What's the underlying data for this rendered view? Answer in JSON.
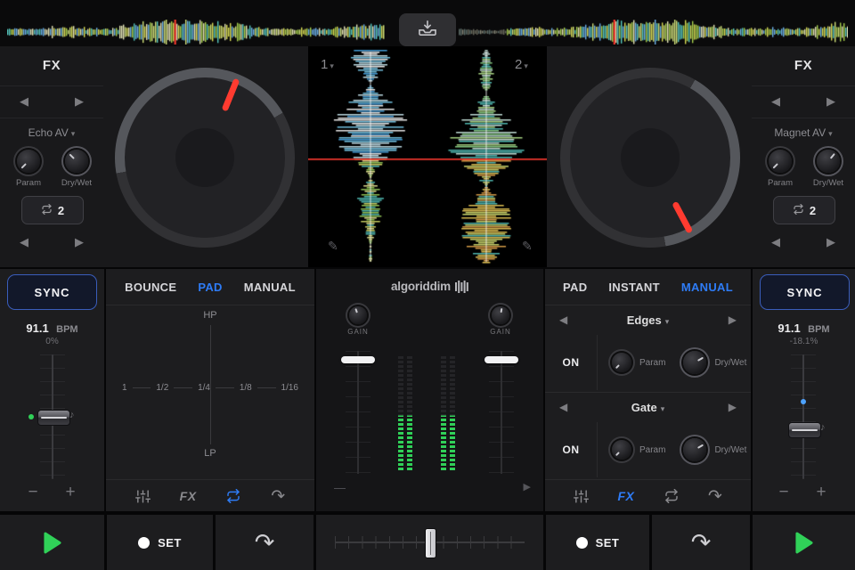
{
  "colors": {
    "accent_blue": "#2e7cf6",
    "playhead_red": "#ff3b30",
    "play_green": "#30d158",
    "meter_green": "#30d158",
    "sync_border": "#3a5dbb"
  },
  "icons": {
    "dropdown": "▾",
    "prev": "◀",
    "next": "▶",
    "redo": "↷",
    "note": "♪",
    "pencil": "✎",
    "minus": "−",
    "plus": "+",
    "dash": "—",
    "mini_next": "▶"
  },
  "center_display": {
    "deck1_label": "1",
    "deck2_label": "2"
  },
  "fx_left": {
    "title": "FX",
    "preset": "Echo AV",
    "param_label": "Param",
    "drywet_label": "Dry/Wet",
    "loop_beats": "2"
  },
  "fx_right": {
    "title": "FX",
    "preset": "Magnet AV",
    "param_label": "Param",
    "drywet_label": "Dry/Wet",
    "loop_beats": "2"
  },
  "deck_left": {
    "sync_label": "SYNC",
    "bpm_value": "91.1",
    "bpm_unit": "BPM",
    "pitch_percent": "0%"
  },
  "deck_right": {
    "sync_label": "SYNC",
    "bpm_value": "91.1",
    "bpm_unit": "BPM",
    "pitch_percent": "-18.1%"
  },
  "pad_left": {
    "tabs": [
      {
        "label": "BOUNCE",
        "active": false
      },
      {
        "label": "PAD",
        "active": true
      },
      {
        "label": "MANUAL",
        "active": false
      }
    ],
    "y_axis_top": "HP",
    "y_axis_bottom": "LP",
    "x_ticks": [
      "1",
      "1/2",
      "1/4",
      "1/8",
      "1/16"
    ],
    "toolbar": {
      "fx_label": "FX",
      "active_loop": true
    }
  },
  "pad_right": {
    "tabs": [
      {
        "label": "PAD",
        "active": false
      },
      {
        "label": "INSTANT",
        "active": false
      },
      {
        "label": "MANUAL",
        "active": true
      }
    ],
    "fx_slots": [
      {
        "name": "Edges",
        "on_label": "ON",
        "param_label": "Param",
        "drywet_label": "Dry/Wet"
      },
      {
        "name": "Gate",
        "on_label": "ON",
        "param_label": "Param",
        "drywet_label": "Dry/Wet"
      }
    ],
    "toolbar": {
      "fx_label": "FX",
      "active_fx": true
    }
  },
  "mixer": {
    "logo": "algoriddim",
    "gain_left_label": "GAIN",
    "gain_right_label": "GAIN"
  },
  "transport": {
    "cue_left_label": "SET",
    "cue_right_label": "SET"
  }
}
